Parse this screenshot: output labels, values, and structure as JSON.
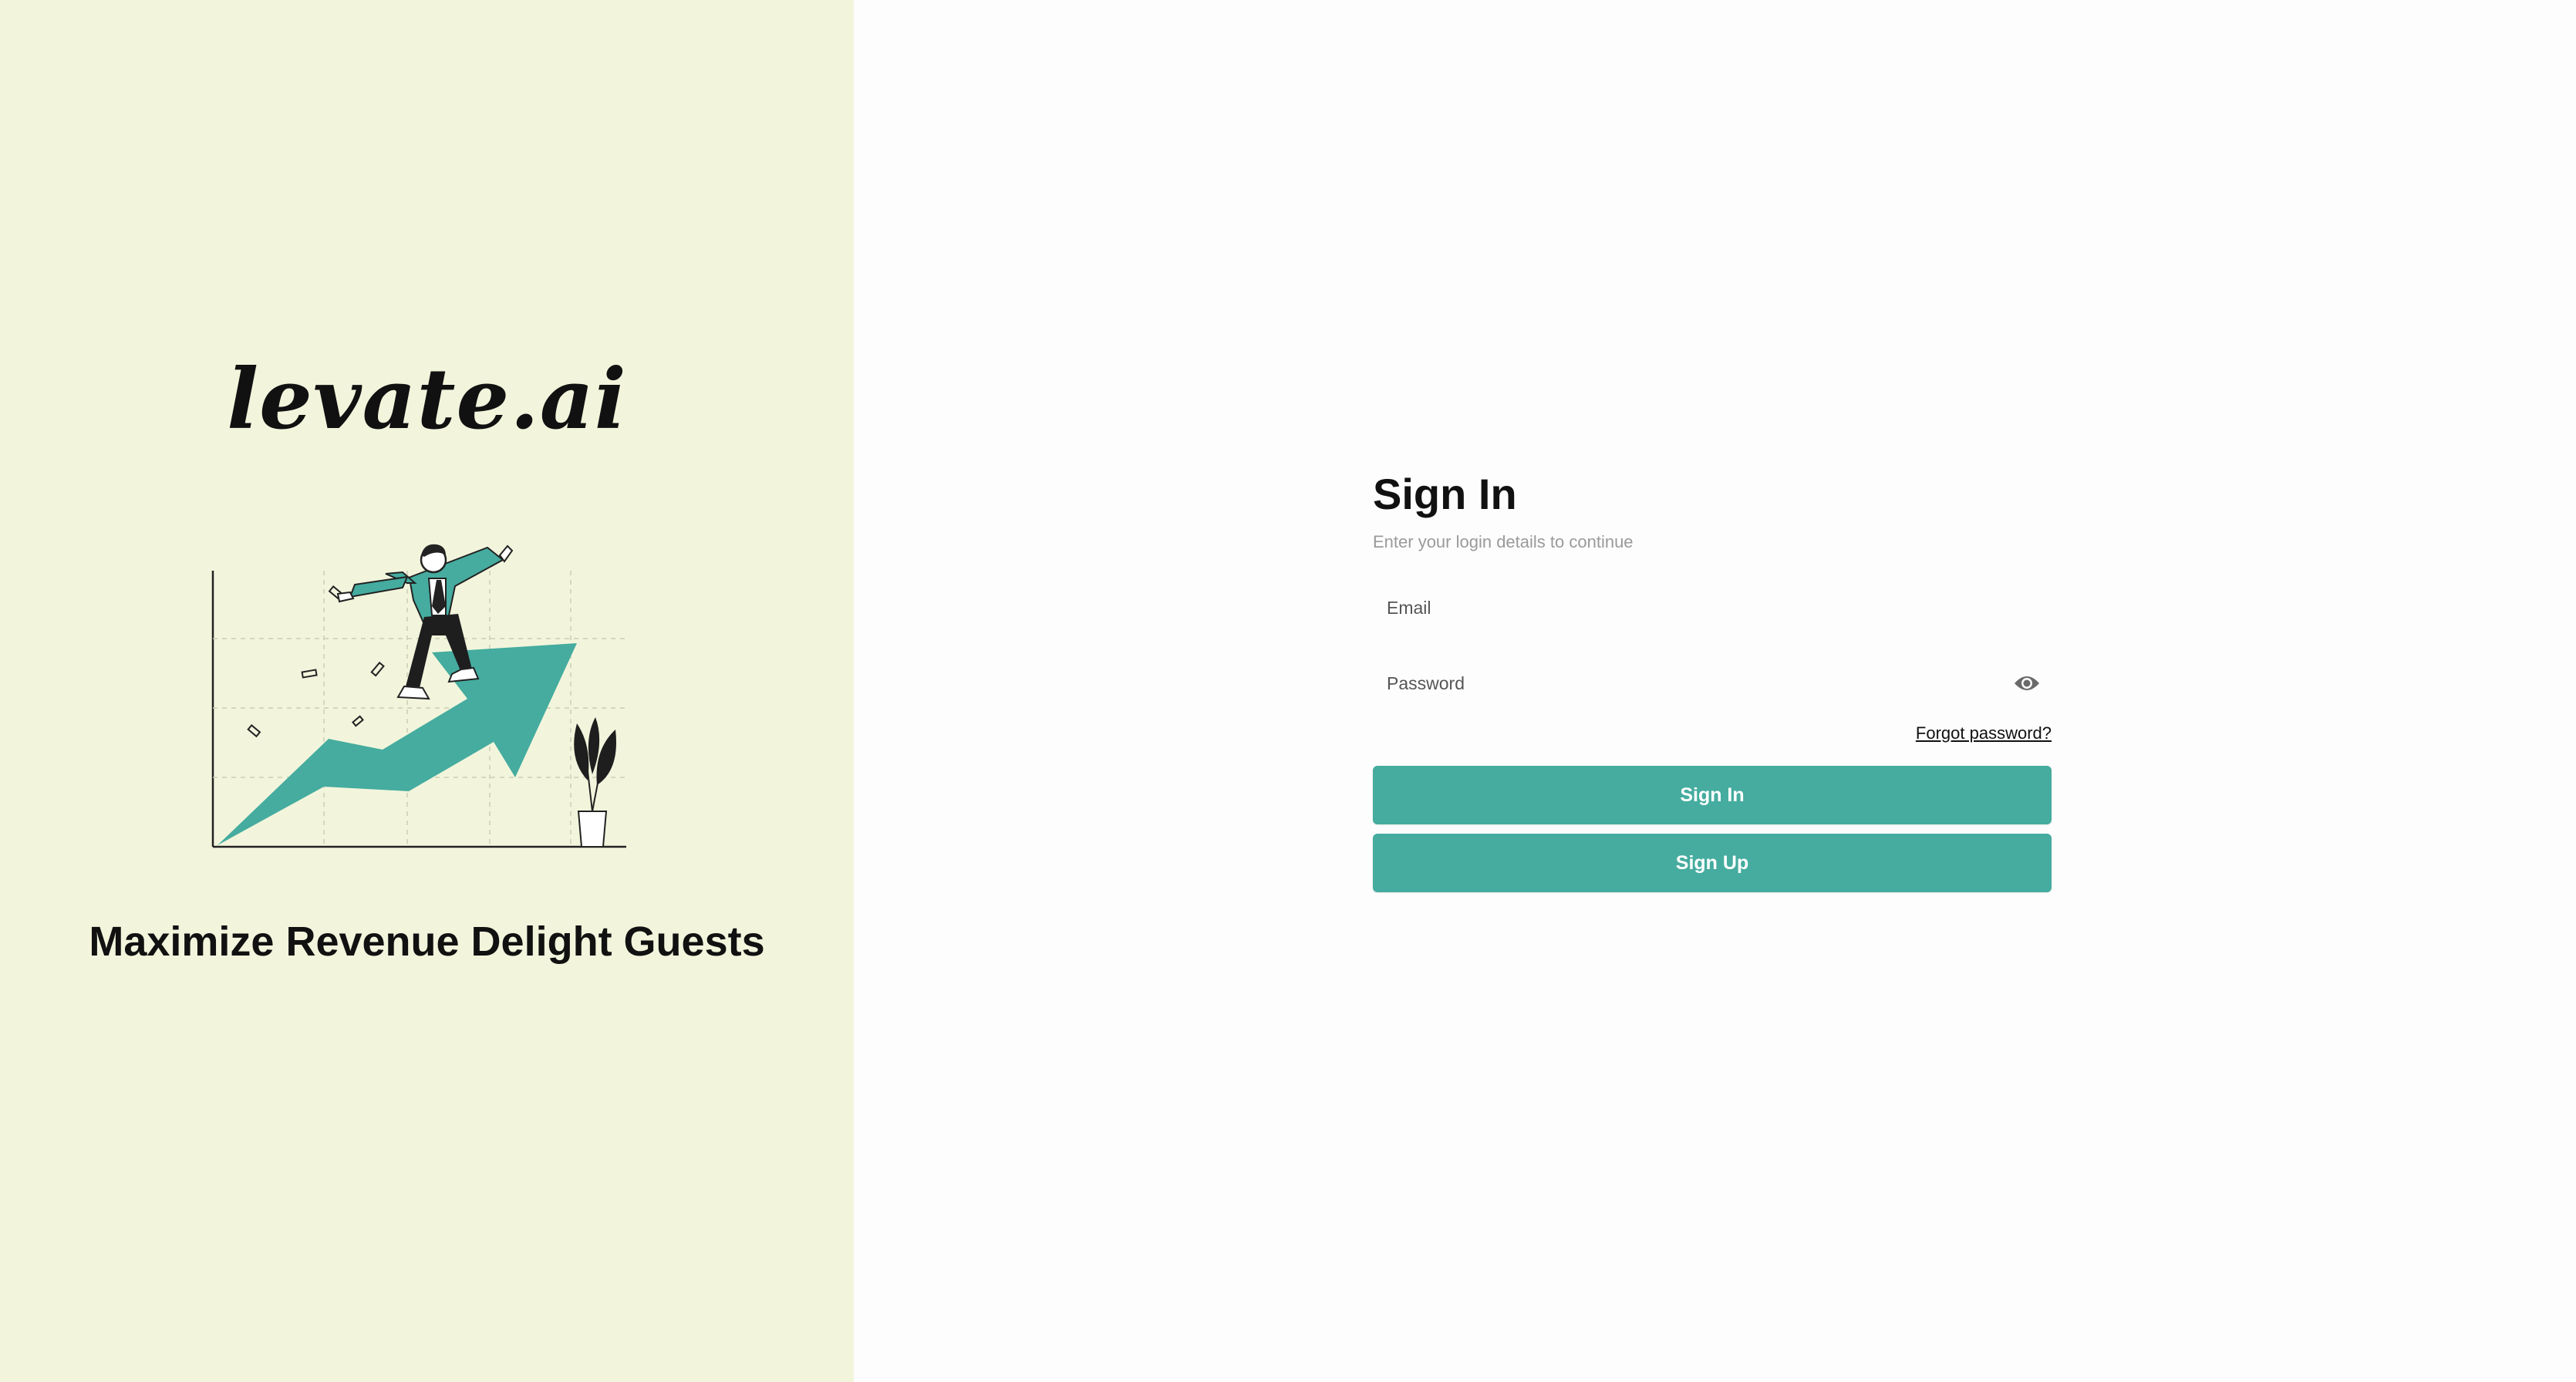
{
  "brand": {
    "logo_text": "levate.ai",
    "tagline": "Maximize Revenue Delight Guests",
    "background_color": "#f2f5dc",
    "accent_color": "#45ac9f"
  },
  "form": {
    "title": "Sign In",
    "subtitle": "Enter your login details to continue",
    "email": {
      "placeholder": "Email",
      "value": ""
    },
    "password": {
      "placeholder": "Password",
      "value": "",
      "toggle_icon": "eye-icon"
    },
    "forgot_password_label": "Forgot password?",
    "sign_in_label": "Sign In",
    "sign_up_label": "Sign Up"
  }
}
